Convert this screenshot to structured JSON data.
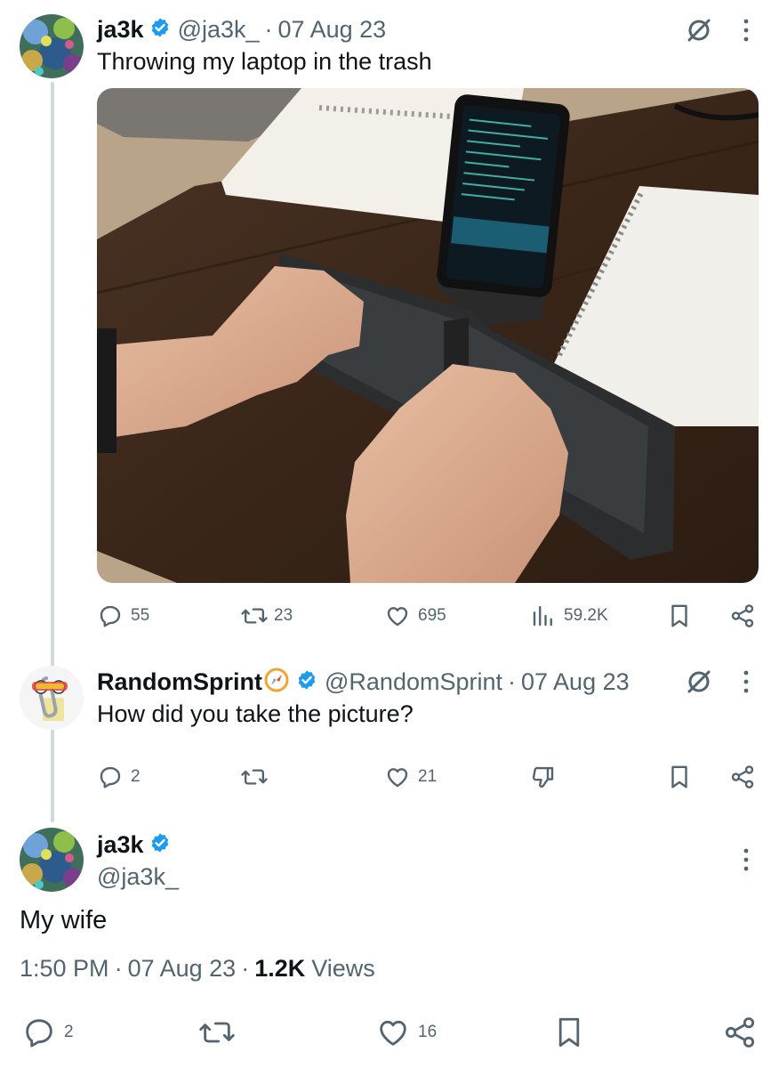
{
  "tweet1": {
    "display_name": "ja3k",
    "handle": "@ja3k_",
    "separator": "·",
    "date": "07 Aug 23",
    "text": "Throwing my laptop in the trash",
    "stats": {
      "replies": "55",
      "retweets": "23",
      "likes": "695",
      "views": "59.2K"
    }
  },
  "tweet2": {
    "display_name": "RandomSprint",
    "handle": "@RandomSprint",
    "separator": "·",
    "date": "07 Aug 23",
    "text": "How did you take the picture?",
    "stats": {
      "replies": "2",
      "likes": "21"
    }
  },
  "tweet3": {
    "display_name": "ja3k",
    "handle": "@ja3k_",
    "text": "My wife",
    "time": "1:50 PM",
    "dot": "·",
    "date": "07 Aug 23",
    "dot2": "·",
    "views_count": "1.2K",
    "views_label": "Views",
    "stats": {
      "replies": "2",
      "likes": "16"
    }
  },
  "colors": {
    "verified": "#1d9bf0",
    "muted": "#536471",
    "thread_line": "#cfd9de"
  },
  "icons": [
    "verified-badge-icon",
    "grok-slash-icon",
    "more-icon",
    "reply-icon",
    "retweet-icon",
    "like-icon",
    "views-icon",
    "bookmark-icon",
    "share-icon",
    "downvote-icon",
    "compass-emoji-icon"
  ]
}
